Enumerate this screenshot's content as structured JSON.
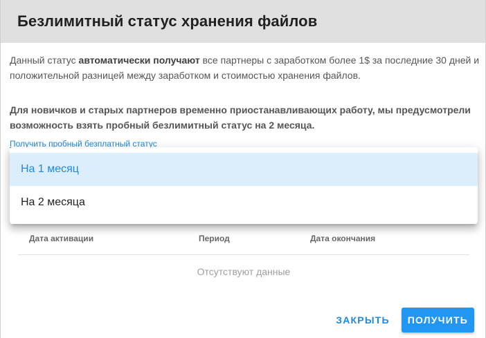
{
  "dialog": {
    "title": "Безлимитный статус хранения файлов"
  },
  "body": {
    "p1_a": "Данный статус ",
    "p1_b": "автоматически получают",
    "p1_c": " все партнеры с заработком более 1$ за последние 30 дней и положительной разницей между заработком и стоимостью хранения файлов.",
    "p2": "Для новичков и старых партнеров временно приостанавливающих работу, мы предусмотрели возможность взять пробный безлимитный статус на 2 месяца.",
    "trial_link": "Получить пробный безплатный статус"
  },
  "menu": {
    "items": [
      {
        "label": "На 1 месяц",
        "selected": true
      },
      {
        "label": "На 2 месяца",
        "selected": false
      }
    ]
  },
  "table": {
    "columns": [
      "Дата активации",
      "Период",
      "Дата окончания"
    ],
    "empty_text": "Отсутствуют данные"
  },
  "actions": {
    "close_label": "ЗАКРЫТЬ",
    "get_label": "ПОЛУЧИТЬ"
  },
  "colors": {
    "accent": "#2196f3",
    "link": "#1e88e5",
    "header_bg": "#e0e0e0",
    "selected_bg": "#dceefb"
  }
}
